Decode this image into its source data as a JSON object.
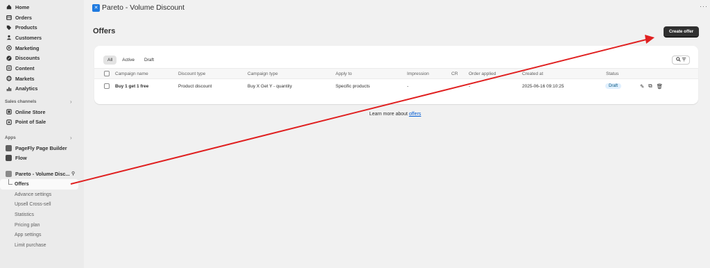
{
  "sidebar": {
    "main_items": [
      {
        "label": "Home",
        "icon": "home-icon"
      },
      {
        "label": "Orders",
        "icon": "orders-icon"
      },
      {
        "label": "Products",
        "icon": "tag-icon"
      },
      {
        "label": "Customers",
        "icon": "person-icon"
      },
      {
        "label": "Marketing",
        "icon": "target-icon"
      },
      {
        "label": "Discounts",
        "icon": "discount-icon"
      },
      {
        "label": "Content",
        "icon": "content-icon"
      },
      {
        "label": "Markets",
        "icon": "globe-icon"
      },
      {
        "label": "Analytics",
        "icon": "chart-icon"
      }
    ],
    "sales_channels_label": "Sales channels",
    "sales_channels": [
      {
        "label": "Online Store",
        "icon": "store-icon"
      },
      {
        "label": "Point of Sale",
        "icon": "pos-icon"
      }
    ],
    "apps_label": "Apps",
    "apps": [
      {
        "label": "PageFly Page Builder",
        "icon": "pagefly-icon"
      },
      {
        "label": "Flow",
        "icon": "flow-icon"
      }
    ],
    "current_app": {
      "label": "Pareto - Volume Disc...",
      "icon": "pareto-icon"
    },
    "sub_items": [
      "Offers",
      "Advance settings",
      "Upsell Cross-sell",
      "Statistics",
      "Pricing plan",
      "App settings",
      "Limit purchase"
    ]
  },
  "header": {
    "app_title": "Pareto - Volume Discount",
    "more": "···"
  },
  "page": {
    "title": "Offers",
    "create_button": "Create offer"
  },
  "tabs": [
    "All",
    "Active",
    "Draft"
  ],
  "table": {
    "columns": [
      "Campaign name",
      "Discount type",
      "Campaign type",
      "Apply to",
      "Impression",
      "CR",
      "Order applied",
      "Created at",
      "Status"
    ],
    "rows": [
      {
        "campaign_name": "Buy 1 get 1 free",
        "discount_type": "Product discount",
        "campaign_type": "Buy X Get Y - quantity",
        "apply_to": "Specific products",
        "impression": "-",
        "cr": "",
        "order_applied": "-",
        "created_at": "2025-06-16 09:10:25",
        "status": "Draft"
      }
    ]
  },
  "footer": {
    "learn_text": "Learn more about ",
    "learn_link": "offers"
  },
  "colors": {
    "annotation_arrow": "#e02020",
    "primary_button": "#303030",
    "badge_bg": "#e0f0ff"
  }
}
